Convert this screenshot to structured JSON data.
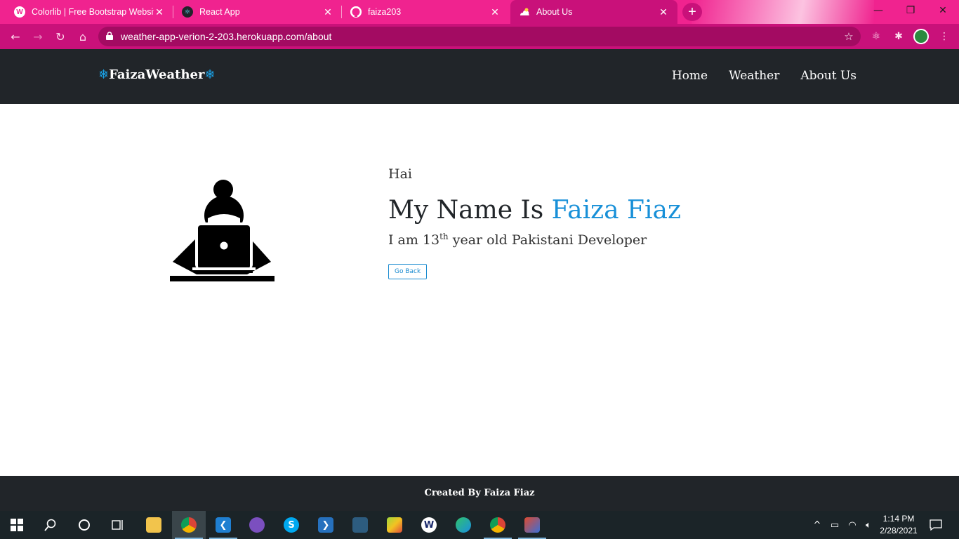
{
  "browser": {
    "tabs": [
      {
        "title": "Colorlib | Free Bootstrap Website",
        "icon": "wordpress-icon",
        "active": false
      },
      {
        "title": "React App",
        "icon": "react-icon",
        "active": false
      },
      {
        "title": "faiza203",
        "icon": "github-icon",
        "active": false
      },
      {
        "title": "About Us",
        "icon": "weather-app-icon",
        "active": true
      }
    ],
    "new_tab_symbol": "+",
    "url": "weather-app-verion-2-203.herokuapp.com/about",
    "theme_color": "#f0238f",
    "toolbar_color": "#c9117a"
  },
  "site": {
    "brand": {
      "flake": "❄",
      "name": "FaizaWeather"
    },
    "nav": [
      {
        "label": "Home"
      },
      {
        "label": "Weather"
      },
      {
        "label": "About Us"
      }
    ],
    "about": {
      "greeting": "Hai",
      "headline_prefix": "My Name Is ",
      "headline_name": "Faiza Fiaz",
      "sub_prefix": "I am 13",
      "sub_sup": "th",
      "sub_suffix": " year old Pakistani Developer",
      "button": "Go Back"
    },
    "footer": "Created By Faiza Fiaz",
    "accent_color": "#1890d8",
    "dark_color": "#212529"
  },
  "taskbar": {
    "apps": [
      {
        "name": "file-explorer-icon"
      },
      {
        "name": "chrome-icon"
      },
      {
        "name": "vscode-icon"
      },
      {
        "name": "github-desktop-icon"
      },
      {
        "name": "skype-icon"
      },
      {
        "name": "powershell-icon"
      },
      {
        "name": "mysql-workbench-icon"
      },
      {
        "name": "bluestacks-icon"
      },
      {
        "name": "app-w-icon"
      },
      {
        "name": "edge-icon"
      },
      {
        "name": "chrome-icon"
      },
      {
        "name": "paint-icon"
      }
    ],
    "time": "1:14 PM",
    "date": "2/28/2021"
  }
}
